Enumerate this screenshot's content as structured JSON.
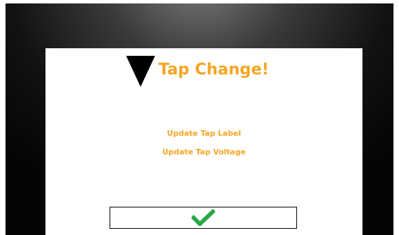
{
  "dialog": {
    "title": "Tap Change!",
    "icon": "warning-triangle-icon",
    "links": {
      "update_tap_label": "Update Tap Label",
      "update_tap_voltage": "Update Tap Voltage"
    },
    "confirm_button": {
      "icon": "checkmark-icon"
    }
  },
  "colors": {
    "accent": "#f5a623",
    "check": "#2aa847",
    "background_dark": "#121212"
  }
}
